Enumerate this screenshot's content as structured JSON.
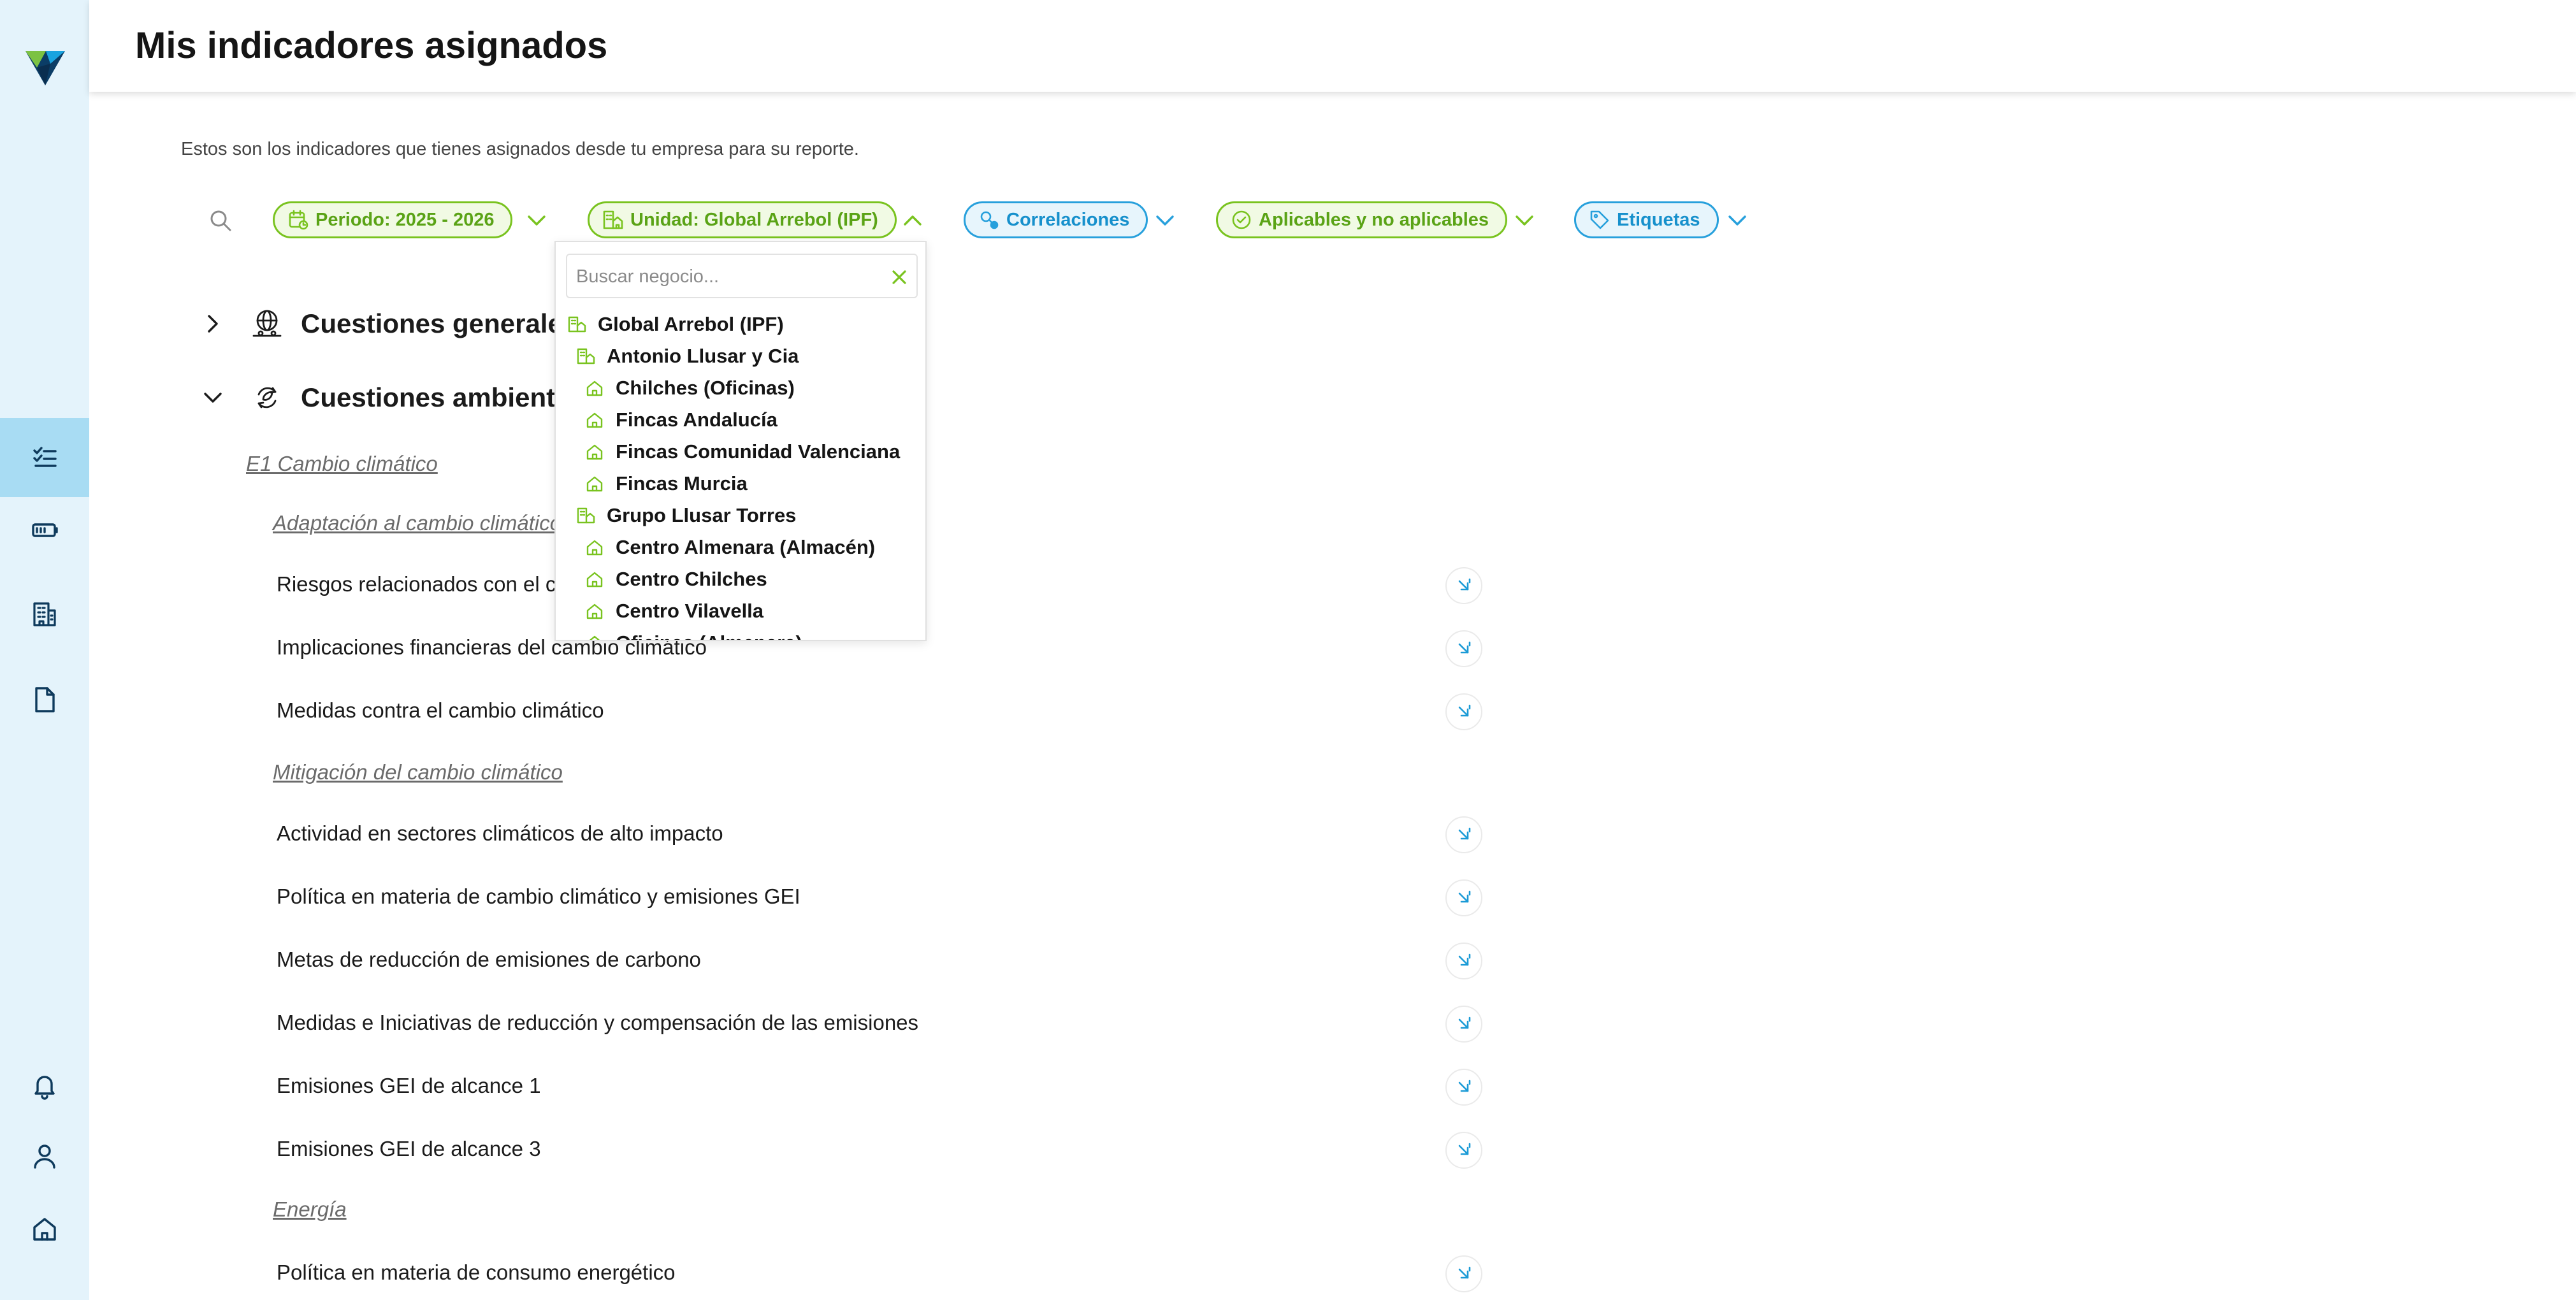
{
  "header": {
    "title": "Mis indicadores asignados"
  },
  "subtitle": "Estos son los indicadores que tienes asignados desde tu empresa para su reporte.",
  "filters": {
    "period": "Periodo: 2025 - 2026",
    "unit": "Unidad: Global Arrebol (IPF)",
    "correlations": "Correlaciones",
    "applicability": "Aplicables y no aplicables",
    "tags": "Etiquetas"
  },
  "dropdown": {
    "search_placeholder": "Buscar negocio...",
    "items": [
      {
        "label": "Global Arrebol (IPF)",
        "level": 0,
        "icon": "building-group-icon"
      },
      {
        "label": "Antonio Llusar y Cia",
        "level": 1,
        "icon": "building-group-icon"
      },
      {
        "label": "Chilches (Oficinas)",
        "level": 2,
        "icon": "home-icon"
      },
      {
        "label": "Fincas Andalucía",
        "level": 2,
        "icon": "home-icon"
      },
      {
        "label": "Fincas Comunidad Valenciana",
        "level": 2,
        "icon": "home-icon"
      },
      {
        "label": "Fincas Murcia",
        "level": 2,
        "icon": "home-icon"
      },
      {
        "label": "Grupo Llusar Torres",
        "level": 1,
        "icon": "building-group-icon"
      },
      {
        "label": "Centro Almenara (Almacén)",
        "level": 2,
        "icon": "home-icon"
      },
      {
        "label": "Centro Chilches",
        "level": 2,
        "icon": "home-icon"
      },
      {
        "label": "Centro Vilavella",
        "level": 2,
        "icon": "home-icon"
      },
      {
        "label": "Oficinas (Almenara)",
        "level": 2,
        "icon": "home-icon"
      }
    ]
  },
  "sections": {
    "general": "Cuestiones generales",
    "environmental": "Cuestiones ambientales"
  },
  "content": {
    "e1": "E1 Cambio climático",
    "adaptacion": "Adaptación al cambio climático",
    "mitigacion": "Mitigación del cambio climático",
    "energia": "Energía",
    "indicators": [
      "Riesgos relacionados con el cambio climático",
      "Implicaciones financieras del cambio climático",
      "Medidas contra el cambio climático",
      "Actividad en sectores climáticos de alto impacto",
      "Política en materia de cambio climático y emisiones GEI",
      "Metas de reducción de emisiones de carbono",
      "Medidas e Iniciativas de reducción y compensación de las emisiones",
      "Emisiones GEI de alcance 1",
      "Emisiones GEI de alcance 3",
      "Política en materia de consumo energético"
    ]
  },
  "colors": {
    "green": "#79c31f",
    "blue": "#27a0dc",
    "sidebar": "#e4f3fb",
    "sidebar_active": "#a8dcf3"
  }
}
